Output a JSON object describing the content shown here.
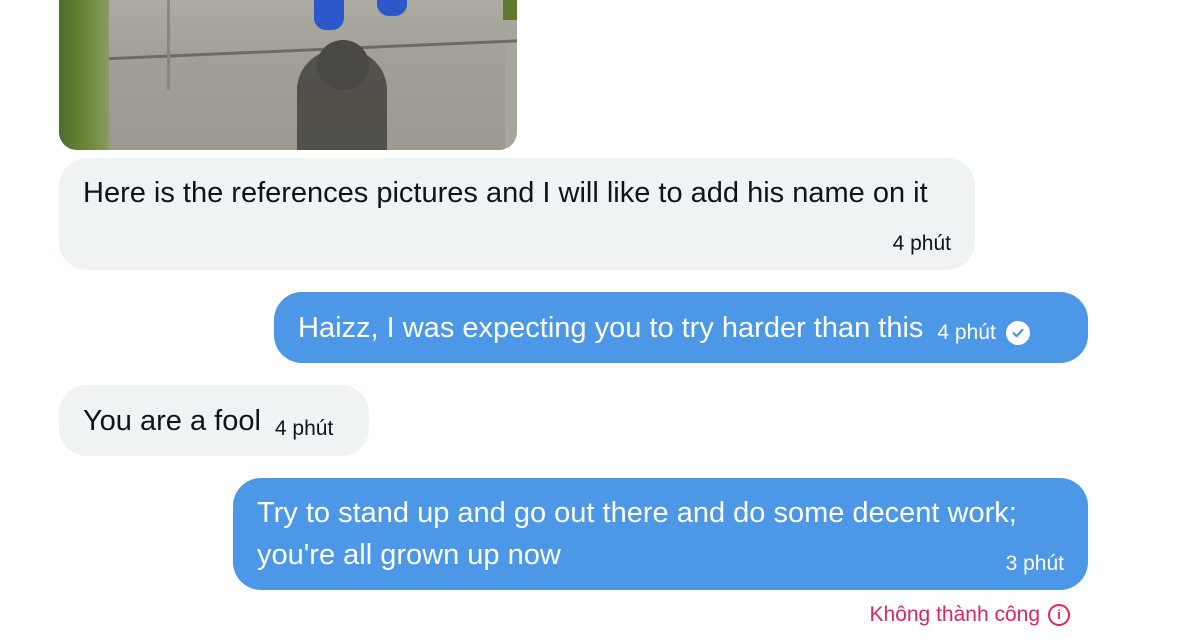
{
  "messages": [
    {
      "direction": "incoming",
      "text": "Here is the references pictures and I will like to add his name on it",
      "time": "4 phút"
    },
    {
      "direction": "outgoing",
      "text": "Haizz, I was expecting you to try harder than this",
      "time": "4 phút",
      "status_icon": "check-circle-icon"
    },
    {
      "direction": "incoming",
      "text": "You are a fool",
      "time": "4 phút"
    },
    {
      "direction": "outgoing",
      "text": "Try to stand up and go out there and do some decent work; you're all grown up now",
      "time": "3 phút"
    }
  ],
  "send_status": {
    "label": "Không thành công",
    "icon": "info-icon",
    "color": "#e0245e"
  },
  "colors": {
    "incoming_bubble": "#eff3f4",
    "outgoing_bubble": "#4c97e6"
  }
}
